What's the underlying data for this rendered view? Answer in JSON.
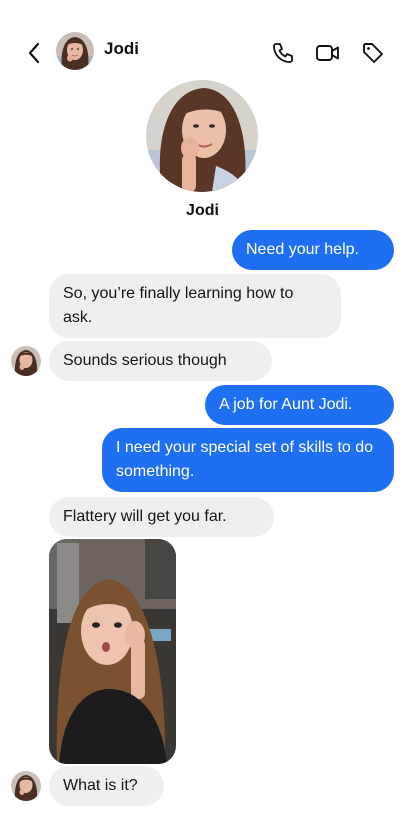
{
  "header": {
    "contact_name": "Jodi",
    "icons": [
      "back-chevron-icon",
      "phone-icon",
      "video-camera-icon",
      "tag-icon"
    ]
  },
  "profile": {
    "name": "Jodi"
  },
  "messages": [
    {
      "sender": "me",
      "text": "Need your help."
    },
    {
      "sender": "Jodi",
      "text": "So, you’re finally learning how to ask."
    },
    {
      "sender": "Jodi",
      "text": "Sounds serious though"
    },
    {
      "sender": "me",
      "text": "A job for Aunt Jodi."
    },
    {
      "sender": "me",
      "text": "I need your special set of skills to do something."
    },
    {
      "sender": "Jodi",
      "text": "Flattery will get you far."
    },
    {
      "sender": "Jodi",
      "type": "video"
    },
    {
      "sender": "Jodi",
      "text": "What is it?"
    }
  ],
  "colors": {
    "outgoing_bubble": "#1f6ff2",
    "incoming_bubble": "#efefef"
  }
}
